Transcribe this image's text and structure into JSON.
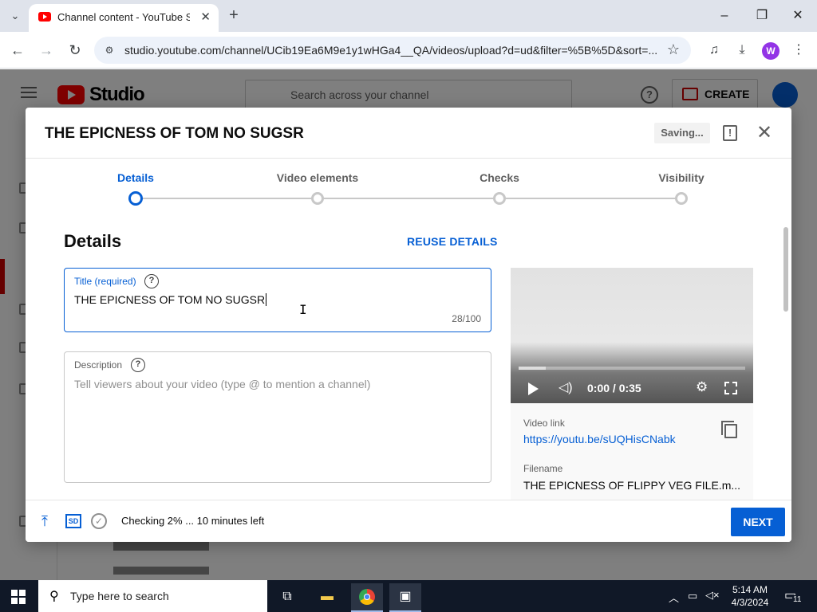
{
  "browser": {
    "tab_title": "Channel content - YouTube Studio",
    "tab_close": "✕",
    "new_tab": "+",
    "url": "studio.youtube.com/channel/UCib19Ea6M9e1y1wHGa4__QA/videos/upload?d=ud&filter=%5B%5D&sort=...",
    "profile_initial": "W"
  },
  "studio": {
    "logo_text": "Studio",
    "search_placeholder": "Search across your channel",
    "create_label": "CREATE"
  },
  "dialog": {
    "title": "THE EPICNESS OF TOM NO SUGSR",
    "saving_label": "Saving...",
    "steps": [
      {
        "label": "Details",
        "active": true
      },
      {
        "label": "Video elements",
        "active": false
      },
      {
        "label": "Checks",
        "active": false
      },
      {
        "label": "Visibility",
        "active": false
      }
    ],
    "section_heading": "Details",
    "reuse_label": "REUSE DETAILS",
    "title_field": {
      "label": "Title (required)",
      "value": "THE EPICNESS OF TOM NO SUGSR",
      "counter": "28/100"
    },
    "description_field": {
      "label": "Description",
      "placeholder": "Tell viewers about your video (type @ to mention a channel)"
    },
    "video": {
      "time": "0:00 / 0:35",
      "progress_fraction": 0.12,
      "link_label": "Video link",
      "link": "https://youtu.be/sUQHisCNabk",
      "filename_label": "Filename",
      "filename": "THE EPICNESS OF FLIPPY VEG FILE.m..."
    },
    "footer": {
      "sd_label": "SD",
      "status": "Checking 2% ... 10 minutes left",
      "next_label": "NEXT"
    }
  },
  "taskbar": {
    "search_text": "Type here to search",
    "time": "5:14 AM",
    "date": "4/3/2024",
    "notification_count": "11"
  },
  "colors": {
    "accent": "#065fd4",
    "youtube_red": "#ff0000",
    "taskbar": "#101827"
  }
}
